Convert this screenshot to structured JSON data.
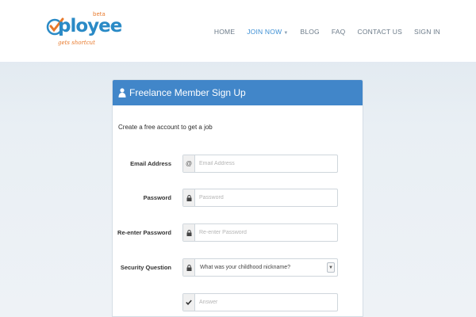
{
  "brand": {
    "logo_text": "ployee",
    "badge": "beta",
    "tagline": "gets shortcut",
    "colors": {
      "blue": "#2a8ac6",
      "orange": "#e8792b"
    }
  },
  "nav": {
    "items": [
      {
        "label": "HOME",
        "active": false
      },
      {
        "label": "JOIN NOW",
        "active": true,
        "has_dropdown": true
      },
      {
        "label": "BLOG",
        "active": false
      },
      {
        "label": "FAQ",
        "active": false
      },
      {
        "label": "CONTACT US",
        "active": false
      },
      {
        "label": "SIGN IN",
        "active": false
      }
    ]
  },
  "form": {
    "title": "Freelance Member Sign Up",
    "subtitle": "Create a free account to get a job",
    "header_color": "#4186c9",
    "email": {
      "label": "Email Address",
      "placeholder": "Email Address",
      "icon": "at-icon"
    },
    "password": {
      "label": "Password",
      "placeholder": "Password",
      "icon": "lock-icon"
    },
    "reenter_password": {
      "label": "Re-enter Password",
      "placeholder": "Re-enter Password",
      "icon": "lock-icon"
    },
    "security_question": {
      "label": "Security Question",
      "selected": "What was your childhood nickname?",
      "icon": "lock-icon"
    },
    "answer": {
      "label": "",
      "placeholder": "Answer",
      "icon": "checkmark-icon"
    }
  }
}
